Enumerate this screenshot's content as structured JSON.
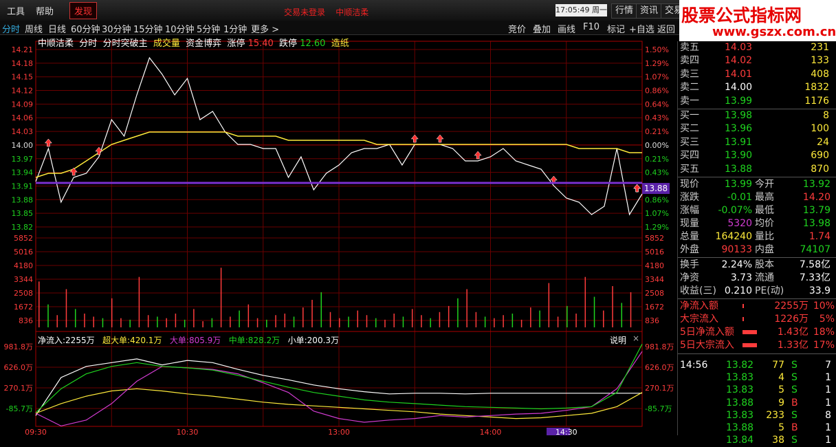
{
  "menubar": {
    "items": [
      "工具",
      "帮助"
    ],
    "discover": "发现",
    "status_login": "交易未登录",
    "status_stock": "中顺洁柔",
    "clock": "17:05:49 周一",
    "buttons": [
      "行情",
      "资讯",
      "交易"
    ]
  },
  "brand": {
    "title": "股票公式指标网",
    "url": "www.gszx.com.cn"
  },
  "periods": [
    "分时",
    "周线",
    "日线",
    "60分钟",
    "30分钟",
    "15分钟",
    "10分钟",
    "5分钟",
    "1分钟",
    "更多"
  ],
  "period_more_arrow": ">",
  "right_buttons": [
    "竞价",
    "叠加",
    "画线",
    "F10",
    "标记",
    "+自选",
    "返回"
  ],
  "chart_header": {
    "stock": "中顺洁柔",
    "mode1": "分时",
    "indicator": "分时突破主",
    "vol": "成交量",
    "fund": "资金博弈",
    "limit_up_label": "涨停",
    "limit_up": "15.40",
    "limit_down_label": "跌停",
    "limit_down": "12.60",
    "extra": "造纸"
  },
  "flow_header": {
    "net": "净流入:2255万",
    "super": "超大单:420.1万",
    "big": "大单:805.9万",
    "mid": "中单:828.2万",
    "small": "小单:200.3万",
    "explain": "说明",
    "close": "×"
  },
  "price_axis_left": [
    "14.21",
    "14.18",
    "14.15",
    "14.12",
    "14.09",
    "14.06",
    "14.03",
    "14.00",
    "13.97",
    "13.94",
    "13.91",
    "13.88",
    "13.85",
    "13.82"
  ],
  "pct_axis_right": [
    "1.50%",
    "1.29%",
    "1.07%",
    "0.86%",
    "0.64%",
    "0.43%",
    "0.21%",
    "0.00%",
    "0.21%",
    "0.43%",
    "0.64%",
    "0.86%",
    "1.07%",
    "1.29%"
  ],
  "vol_axis": [
    "5852",
    "5016",
    "4180",
    "3344",
    "2508",
    "1672",
    "836"
  ],
  "flow_axis": [
    "981.8万",
    "626.0万",
    "270.1万",
    "-85.7万"
  ],
  "current_price_tag": "13.88",
  "time_axis": [
    "09:30",
    "10:30",
    "13:00",
    "14:00",
    "14:30"
  ],
  "chart_data": [
    {
      "type": "line",
      "name_series": "price",
      "ylim": [
        13.8,
        14.23
      ],
      "x_minutes": [
        0,
        5,
        10,
        15,
        20,
        25,
        30,
        35,
        40,
        45,
        50,
        55,
        60,
        65,
        70,
        75,
        80,
        85,
        90,
        95,
        100,
        105,
        110,
        115,
        120,
        125,
        130,
        135,
        140,
        145,
        150,
        155,
        160,
        165,
        170,
        175,
        180,
        185,
        190,
        195,
        200,
        205,
        210,
        215,
        220,
        225,
        230,
        235,
        240
      ],
      "series": [
        {
          "name": "price",
          "values": [
            13.91,
            13.99,
            13.86,
            13.92,
            13.93,
            13.97,
            14.06,
            14.02,
            14.12,
            14.21,
            14.17,
            14.12,
            14.16,
            14.06,
            14.08,
            14.03,
            14.0,
            14.0,
            13.99,
            13.99,
            13.92,
            13.97,
            13.89,
            13.93,
            13.95,
            13.98,
            13.99,
            13.99,
            14.0,
            13.95,
            14.0,
            14.0,
            14.0,
            13.99,
            13.96,
            13.96,
            13.97,
            13.99,
            13.96,
            13.95,
            13.94,
            13.9,
            13.87,
            13.86,
            13.83,
            13.85,
            13.99,
            13.83,
            13.88
          ]
        },
        {
          "name": "avg",
          "values": [
            13.92,
            13.93,
            13.93,
            13.94,
            13.96,
            13.98,
            14.0,
            14.01,
            14.02,
            14.03,
            14.03,
            14.03,
            14.03,
            14.03,
            14.03,
            14.03,
            14.02,
            14.02,
            14.02,
            14.02,
            14.01,
            14.01,
            14.01,
            14.01,
            14.01,
            14.01,
            14.01,
            14.0,
            14.0,
            14.0,
            14.0,
            14.0,
            14.0,
            14.0,
            14.0,
            14.0,
            14.0,
            14.0,
            14.0,
            14.0,
            14.0,
            14.0,
            14.0,
            13.99,
            13.99,
            13.99,
            13.99,
            13.98,
            13.98
          ]
        }
      ]
    },
    {
      "type": "bar",
      "name_series": "volume",
      "ylim": [
        0,
        5852
      ],
      "values": [
        3000,
        1500,
        800,
        2500,
        1200,
        900,
        700,
        600,
        1900,
        600,
        500,
        3300,
        800,
        700,
        600,
        900,
        500,
        1200,
        400,
        600,
        3900,
        700,
        1100,
        1500,
        600,
        500,
        800,
        900,
        700,
        1300,
        1800,
        2300,
        1000,
        600,
        700,
        1100,
        800,
        600,
        500,
        900,
        700,
        1200,
        800,
        600,
        1000,
        1400,
        1900,
        2500,
        1000,
        700,
        600,
        800,
        900,
        500,
        1300,
        1100,
        2900,
        700,
        1400,
        900,
        3300,
        2000,
        1100,
        2700,
        1600,
        2300
      ]
    },
    {
      "type": "line",
      "name_series": "fund_flow",
      "ylim": [
        -150,
        1050
      ],
      "x_minutes": [
        0,
        10,
        20,
        30,
        40,
        50,
        60,
        70,
        80,
        90,
        100,
        110,
        120,
        130,
        140,
        150,
        160,
        170,
        180,
        190,
        200,
        210,
        220,
        230,
        240
      ],
      "series": [
        {
          "name": "净流入",
          "values": [
            -60,
            450,
            600,
            650,
            700,
            620,
            680,
            650,
            560,
            480,
            420,
            350,
            300,
            260,
            230,
            240,
            240,
            230,
            240,
            240,
            240,
            240,
            240,
            240,
            240
          ]
        },
        {
          "name": "超大单",
          "values": [
            -30,
            100,
            200,
            270,
            300,
            270,
            230,
            200,
            160,
            120,
            90,
            70,
            50,
            30,
            10,
            -10,
            -40,
            -60,
            -80,
            -100,
            -90,
            -60,
            -30,
            60,
            250
          ]
        },
        {
          "name": "大单",
          "values": [
            -30,
            -200,
            -120,
            100,
            400,
            600,
            580,
            560,
            500,
            380,
            250,
            0,
            -100,
            -150,
            -120,
            -100,
            -60,
            -80,
            -60,
            -40,
            -30,
            10,
            60,
            300,
            800
          ]
        },
        {
          "name": "中单",
          "values": [
            -20,
            300,
            500,
            600,
            650,
            600,
            580,
            550,
            480,
            400,
            320,
            250,
            200,
            150,
            120,
            100,
            80,
            60,
            50,
            40,
            30,
            40,
            60,
            250,
            900
          ]
        }
      ]
    }
  ],
  "panel": {
    "asks": [
      {
        "label": "卖五",
        "price": "14.03",
        "vol": "231"
      },
      {
        "label": "卖四",
        "price": "14.02",
        "vol": "133"
      },
      {
        "label": "卖三",
        "price": "14.01",
        "vol": "408"
      },
      {
        "label": "卖二",
        "price": "14.00",
        "vol": "1832"
      },
      {
        "label": "卖一",
        "price": "13.99",
        "vol": "1176"
      }
    ],
    "bids": [
      {
        "label": "买一",
        "price": "13.98",
        "vol": "8"
      },
      {
        "label": "买二",
        "price": "13.96",
        "vol": "100"
      },
      {
        "label": "买三",
        "price": "13.91",
        "vol": "24"
      },
      {
        "label": "买四",
        "price": "13.90",
        "vol": "690"
      },
      {
        "label": "买五",
        "price": "13.88",
        "vol": "870"
      }
    ],
    "quote": [
      {
        "l1": "现价",
        "v1": "13.99",
        "l2": "今开",
        "v2": "13.92"
      },
      {
        "l1": "涨跌",
        "v1": "-0.01",
        "l2": "最高",
        "v2": "14.20"
      },
      {
        "l1": "涨幅",
        "v1": "-0.07%",
        "l2": "最低",
        "v2": "13.79"
      },
      {
        "l1": "现量",
        "v1": "5320",
        "l2": "均价",
        "v2": "13.98"
      },
      {
        "l1": "总量",
        "v1": "164240",
        "l2": "量比",
        "v2": "1.74"
      },
      {
        "l1": "外盘",
        "v1": "90133",
        "l2": "内盘",
        "v2": "74107"
      }
    ],
    "stats": [
      {
        "l1": "换手",
        "v1": "2.24%",
        "l2": "股本",
        "v2": "7.58亿"
      },
      {
        "l1": "净资",
        "v1": "3.73",
        "l2": "流通",
        "v2": "7.33亿"
      },
      {
        "l1": "收益(三)",
        "v1": "0.210",
        "l2": "PE(动)",
        "v2": "33.9"
      }
    ],
    "flows": [
      {
        "label": "净流入额",
        "value": "2255万",
        "pct": "10%",
        "bar": 0.05
      },
      {
        "label": "大宗流入",
        "value": "1226万",
        "pct": "5%",
        "bar": 0.03
      },
      {
        "label": "5日净流入额",
        "value": "1.43亿",
        "pct": "18%",
        "bar": 0.7
      },
      {
        "label": "5日大宗流入",
        "value": "1.33亿",
        "pct": "17%",
        "bar": 0.7
      }
    ],
    "ticks": [
      {
        "time": "14:56",
        "price": "13.82",
        "vol": "77",
        "side": "S",
        "n": "7"
      },
      {
        "time": "",
        "price": "13.83",
        "vol": "4",
        "side": "S",
        "n": "1"
      },
      {
        "time": "",
        "price": "13.83",
        "vol": "5",
        "side": "S",
        "n": "1"
      },
      {
        "time": "",
        "price": "13.88",
        "vol": "9",
        "side": "B",
        "n": "1"
      },
      {
        "time": "",
        "price": "13.83",
        "vol": "233",
        "side": "S",
        "n": "8"
      },
      {
        "time": "",
        "price": "13.88",
        "vol": "5",
        "side": "B",
        "n": "1"
      },
      {
        "time": "",
        "price": "13.84",
        "vol": "38",
        "side": "S",
        "n": "1"
      }
    ]
  },
  "colors": {
    "red": "#ff3c3c",
    "green": "#1fd41f",
    "yellow": "#ffeb3b",
    "purple": "#7b2fd0",
    "magenta": "#d23cd2"
  }
}
